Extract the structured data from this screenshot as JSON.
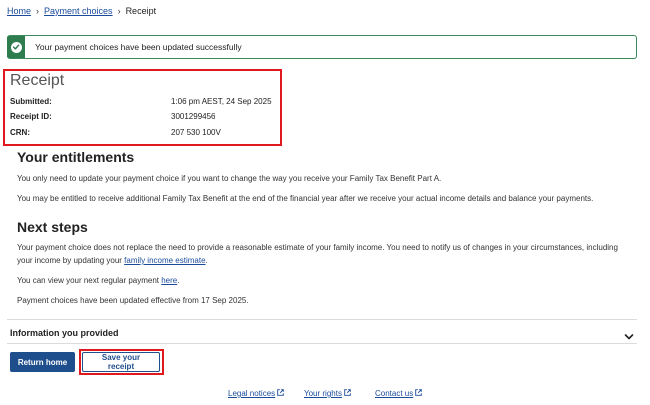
{
  "breadcrumb": {
    "home": "Home",
    "separator": "›",
    "payment_choices": "Payment choices",
    "current": "Receipt"
  },
  "alert": {
    "message": "Your payment choices have been updated successfully",
    "icon": "check-circle-icon",
    "color": "#2f7d4f"
  },
  "receipt": {
    "title": "Receipt",
    "rows": [
      {
        "label": "Submitted:",
        "value": "1:06 pm AEST, 24 Sep 2025"
      },
      {
        "label": "Receipt ID:",
        "value": "3001299456"
      },
      {
        "label": "CRN:",
        "value": "207 530 100V"
      }
    ]
  },
  "entitlements": {
    "heading": "Your entitlements",
    "p1": "You only need to update your payment choice if you want to change the way you receive your Family Tax Benefit Part A.",
    "p2": "You may be entitled to receive additional Family Tax Benefit at the end of the financial year after we receive your actual income details and balance your payments."
  },
  "next_steps": {
    "heading": "Next steps",
    "p1_start": "Your payment choice does not replace the need to provide a reasonable estimate of your family income. You need to notify us of changes in your circumstances, including your income by updating your ",
    "p1_link": "family income estimate",
    "p1_end": ".",
    "p2_start": "You can view your next regular payment ",
    "p2_link": "here",
    "p2_end": ".",
    "p3": "Payment choices have been updated effective from 17 Sep 2025."
  },
  "info": {
    "label": "Information you provided",
    "icon": "chevron-down-icon"
  },
  "buttons": {
    "return_home": "Return home",
    "save_receipt": "Save your receipt"
  },
  "footer": {
    "legal": "Legal notices",
    "rights": "Your rights",
    "contact": "Contact us",
    "icon": "external-link-icon"
  },
  "colors": {
    "link": "#1a4a9a",
    "primary": "#1f4e8c",
    "highlight": "#e0191e",
    "success": "#2f7d4f"
  }
}
